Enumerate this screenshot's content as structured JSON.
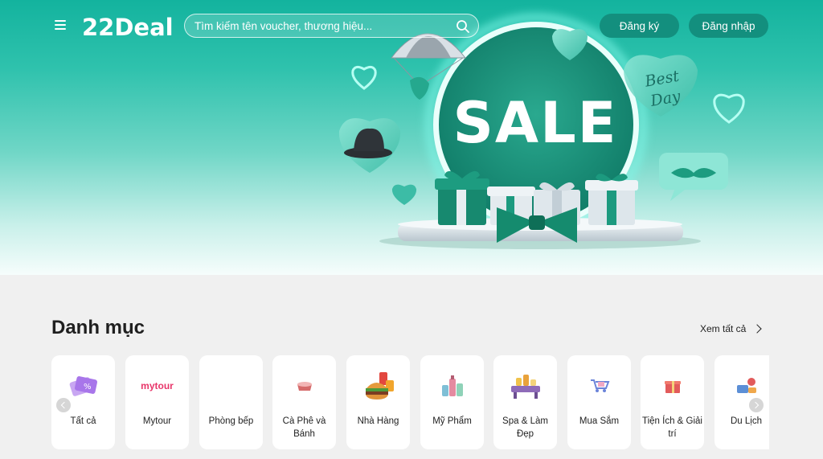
{
  "header": {
    "logo_text": "22Deal",
    "search": {
      "placeholder": "Tìm kiếm tên voucher, thương hiệu..."
    },
    "register_label": "Đăng ký",
    "login_label": "Đăng nhập"
  },
  "banner": {
    "sale_text": "SALE",
    "badge_line1": "Best",
    "badge_line2": "Day"
  },
  "categories": {
    "title": "Danh mục",
    "view_all_label": "Xem tất cả",
    "items": [
      {
        "label": "Tất cả",
        "icon": "coupon-icon"
      },
      {
        "label": "Mytour",
        "icon": "mytour-logo",
        "logo_text": "mytour"
      },
      {
        "label": "Phòng bếp",
        "icon": "kitchen-icon"
      },
      {
        "label": "Cà Phê và Bánh",
        "icon": "coffee-cake-icon"
      },
      {
        "label": "Nhà Hàng",
        "icon": "burger-icon"
      },
      {
        "label": "Mỹ Phẩm",
        "icon": "cosmetics-icon"
      },
      {
        "label": "Spa & Làm Đẹp",
        "icon": "spa-icon"
      },
      {
        "label": "Mua Sắm",
        "icon": "shopping-cart-icon"
      },
      {
        "label": "Tiện Ích & Giải trí",
        "icon": "gift-icon"
      },
      {
        "label": "Du Lịch",
        "icon": "travel-icon"
      }
    ]
  },
  "colors": {
    "brand": "#13b39e",
    "button_bg": "#138f7e",
    "mytour": "#e8366a"
  }
}
